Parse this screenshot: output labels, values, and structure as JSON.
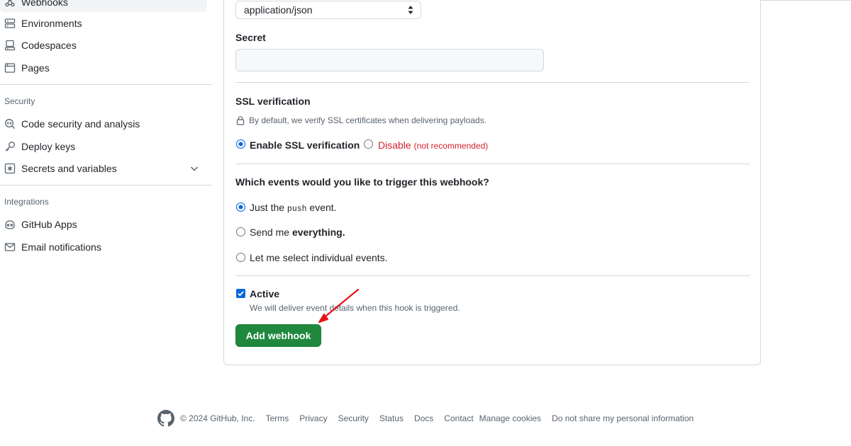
{
  "sidebar": {
    "items_top": [
      {
        "label": "Webhooks",
        "icon": "webhook-icon"
      },
      {
        "label": "Environments",
        "icon": "server-icon"
      },
      {
        "label": "Codespaces",
        "icon": "codespaces-icon"
      },
      {
        "label": "Pages",
        "icon": "browser-icon"
      }
    ],
    "security_heading": "Security",
    "security_items": [
      {
        "label": "Code security and analysis",
        "icon": "codescan-icon"
      },
      {
        "label": "Deploy keys",
        "icon": "key-icon"
      },
      {
        "label": "Secrets and variables",
        "icon": "asterisk-icon"
      }
    ],
    "integrations_heading": "Integrations",
    "integrations_items": [
      {
        "label": "GitHub Apps",
        "icon": "copilot-icon"
      },
      {
        "label": "Email notifications",
        "icon": "mail-icon"
      }
    ]
  },
  "form": {
    "content_type_value": "application/json",
    "secret_label": "Secret",
    "secret_value": "",
    "ssl_heading": "SSL verification",
    "ssl_note": "By default, we verify SSL certificates when delivering payloads.",
    "ssl_enable_label": "Enable SSL verification",
    "ssl_disable_label": "Disable",
    "ssl_disable_note": "(not recommended)",
    "events_heading": "Which events would you like to trigger this webhook?",
    "event_push_prefix": "Just the",
    "event_push_code": "push",
    "event_push_suffix": "event.",
    "event_all_prefix": "Send me",
    "event_all_bold": "everything.",
    "event_select_label": "Let me select individual events.",
    "active_label": "Active",
    "active_note": "We will deliver event details when this hook is triggered.",
    "submit_label": "Add webhook"
  },
  "footer": {
    "copyright": "© 2024 GitHub, Inc.",
    "links": [
      "Terms",
      "Privacy",
      "Security",
      "Status",
      "Docs",
      "Contact",
      "Manage cookies",
      "Do not share my personal information"
    ]
  },
  "colors": {
    "primary_button": "#1f883d",
    "accent_blue": "#0969da",
    "danger_red": "#d1242f",
    "annotation_arrow": "#e8121a"
  }
}
